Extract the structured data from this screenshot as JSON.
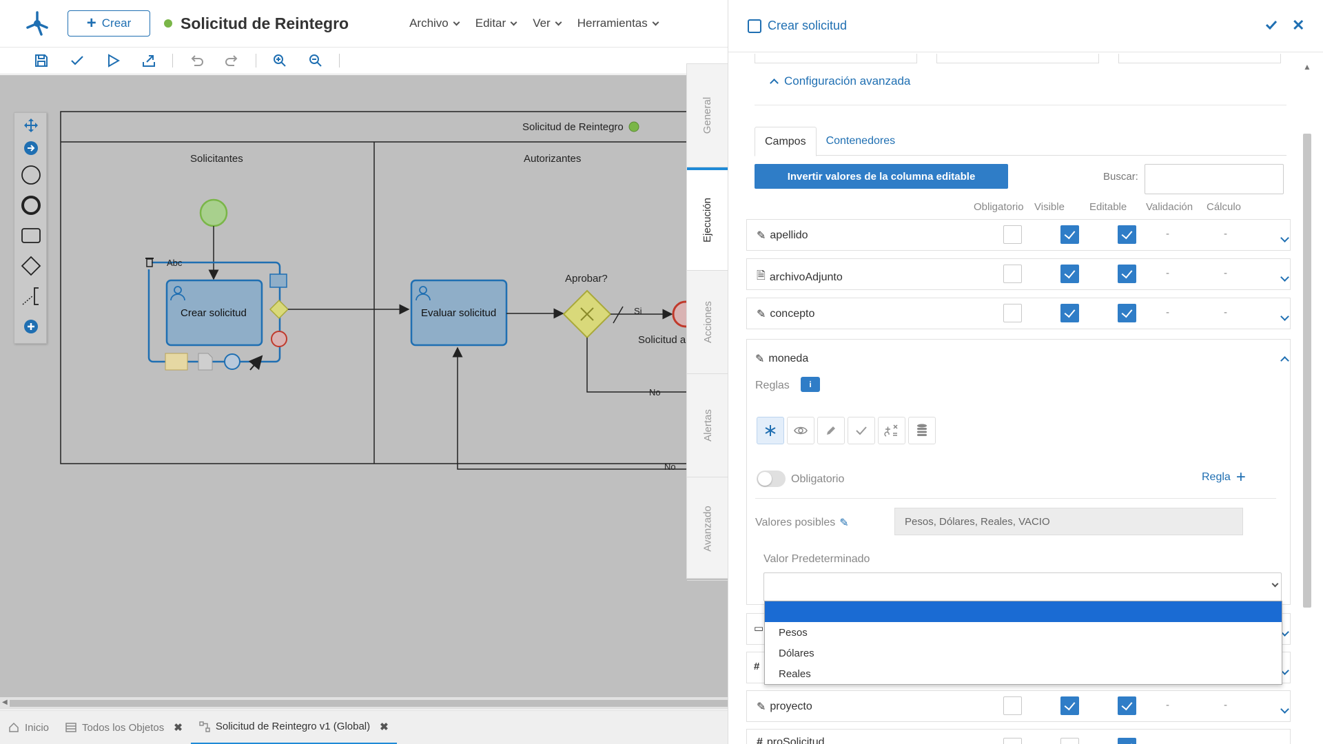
{
  "header": {
    "create_label": "Crear",
    "title": "Solicitud de Reintegro",
    "menus": [
      "Archivo",
      "Editar",
      "Ver",
      "Herramientas"
    ]
  },
  "toolbar": {
    "icons": [
      "save-icon",
      "check-icon",
      "play-icon",
      "export-icon",
      "undo-icon",
      "redo-icon",
      "zoom-in-icon",
      "zoom-out-icon"
    ]
  },
  "diagram": {
    "pool_title": "Solicitud de Reintegro",
    "lane_left": "Solicitantes",
    "lane_right": "Autorizantes",
    "task1": "Crear solicitud",
    "task2": "Evaluar solicitud",
    "gateway_label": "Aprobar?",
    "yes_label": "Si",
    "no_label_1": "No",
    "no_label_2": "No",
    "end_label": "Solicitud ap",
    "abc_label": "Abc"
  },
  "bottom_tabs": [
    {
      "label": "Inicio"
    },
    {
      "label": "Todos los Objetos"
    },
    {
      "label": "Solicitud de Reintegro v1 (Global)"
    }
  ],
  "side_tabs": [
    "General",
    "Ejecución",
    "Acciones",
    "Alertas",
    "Avanzado"
  ],
  "panel": {
    "title": "Crear solicitud",
    "advanced_label": "Configuración avanzada",
    "tabs": [
      "Campos",
      "Contenedores"
    ],
    "invert_label": "Invertir valores de la columna editable",
    "search_label": "Buscar:",
    "search_value": "",
    "columns": [
      "Obligatorio",
      "Visible",
      "Editable",
      "Validación",
      "Cálculo"
    ],
    "dash": "-",
    "fields": [
      {
        "name": "apellido",
        "obligatorio": false,
        "visible": true,
        "editable": true
      },
      {
        "name": "archivoAdjunto",
        "obligatorio": false,
        "visible": true,
        "editable": true
      },
      {
        "name": "concepto",
        "obligatorio": false,
        "visible": true,
        "editable": true
      },
      {
        "name": "proyecto",
        "obligatorio": false,
        "visible": true,
        "editable": true
      },
      {
        "name": "proSolicitud"
      }
    ],
    "moneda": {
      "name": "moneda",
      "rules_label": "Reglas",
      "toggle_label": "Obligatorio",
      "add_rule_label": "Regla",
      "values_label": "Valores posibles",
      "values": "Pesos, Dólares, Reales, VACIO",
      "default_label": "Valor Predeterminado",
      "options": [
        "",
        "Pesos",
        "Dólares",
        "Reales"
      ]
    }
  },
  "colors": {
    "accent": "#1f6fb2",
    "primary_button": "#2f7dc7",
    "selected_option": "#1a6bd3"
  }
}
